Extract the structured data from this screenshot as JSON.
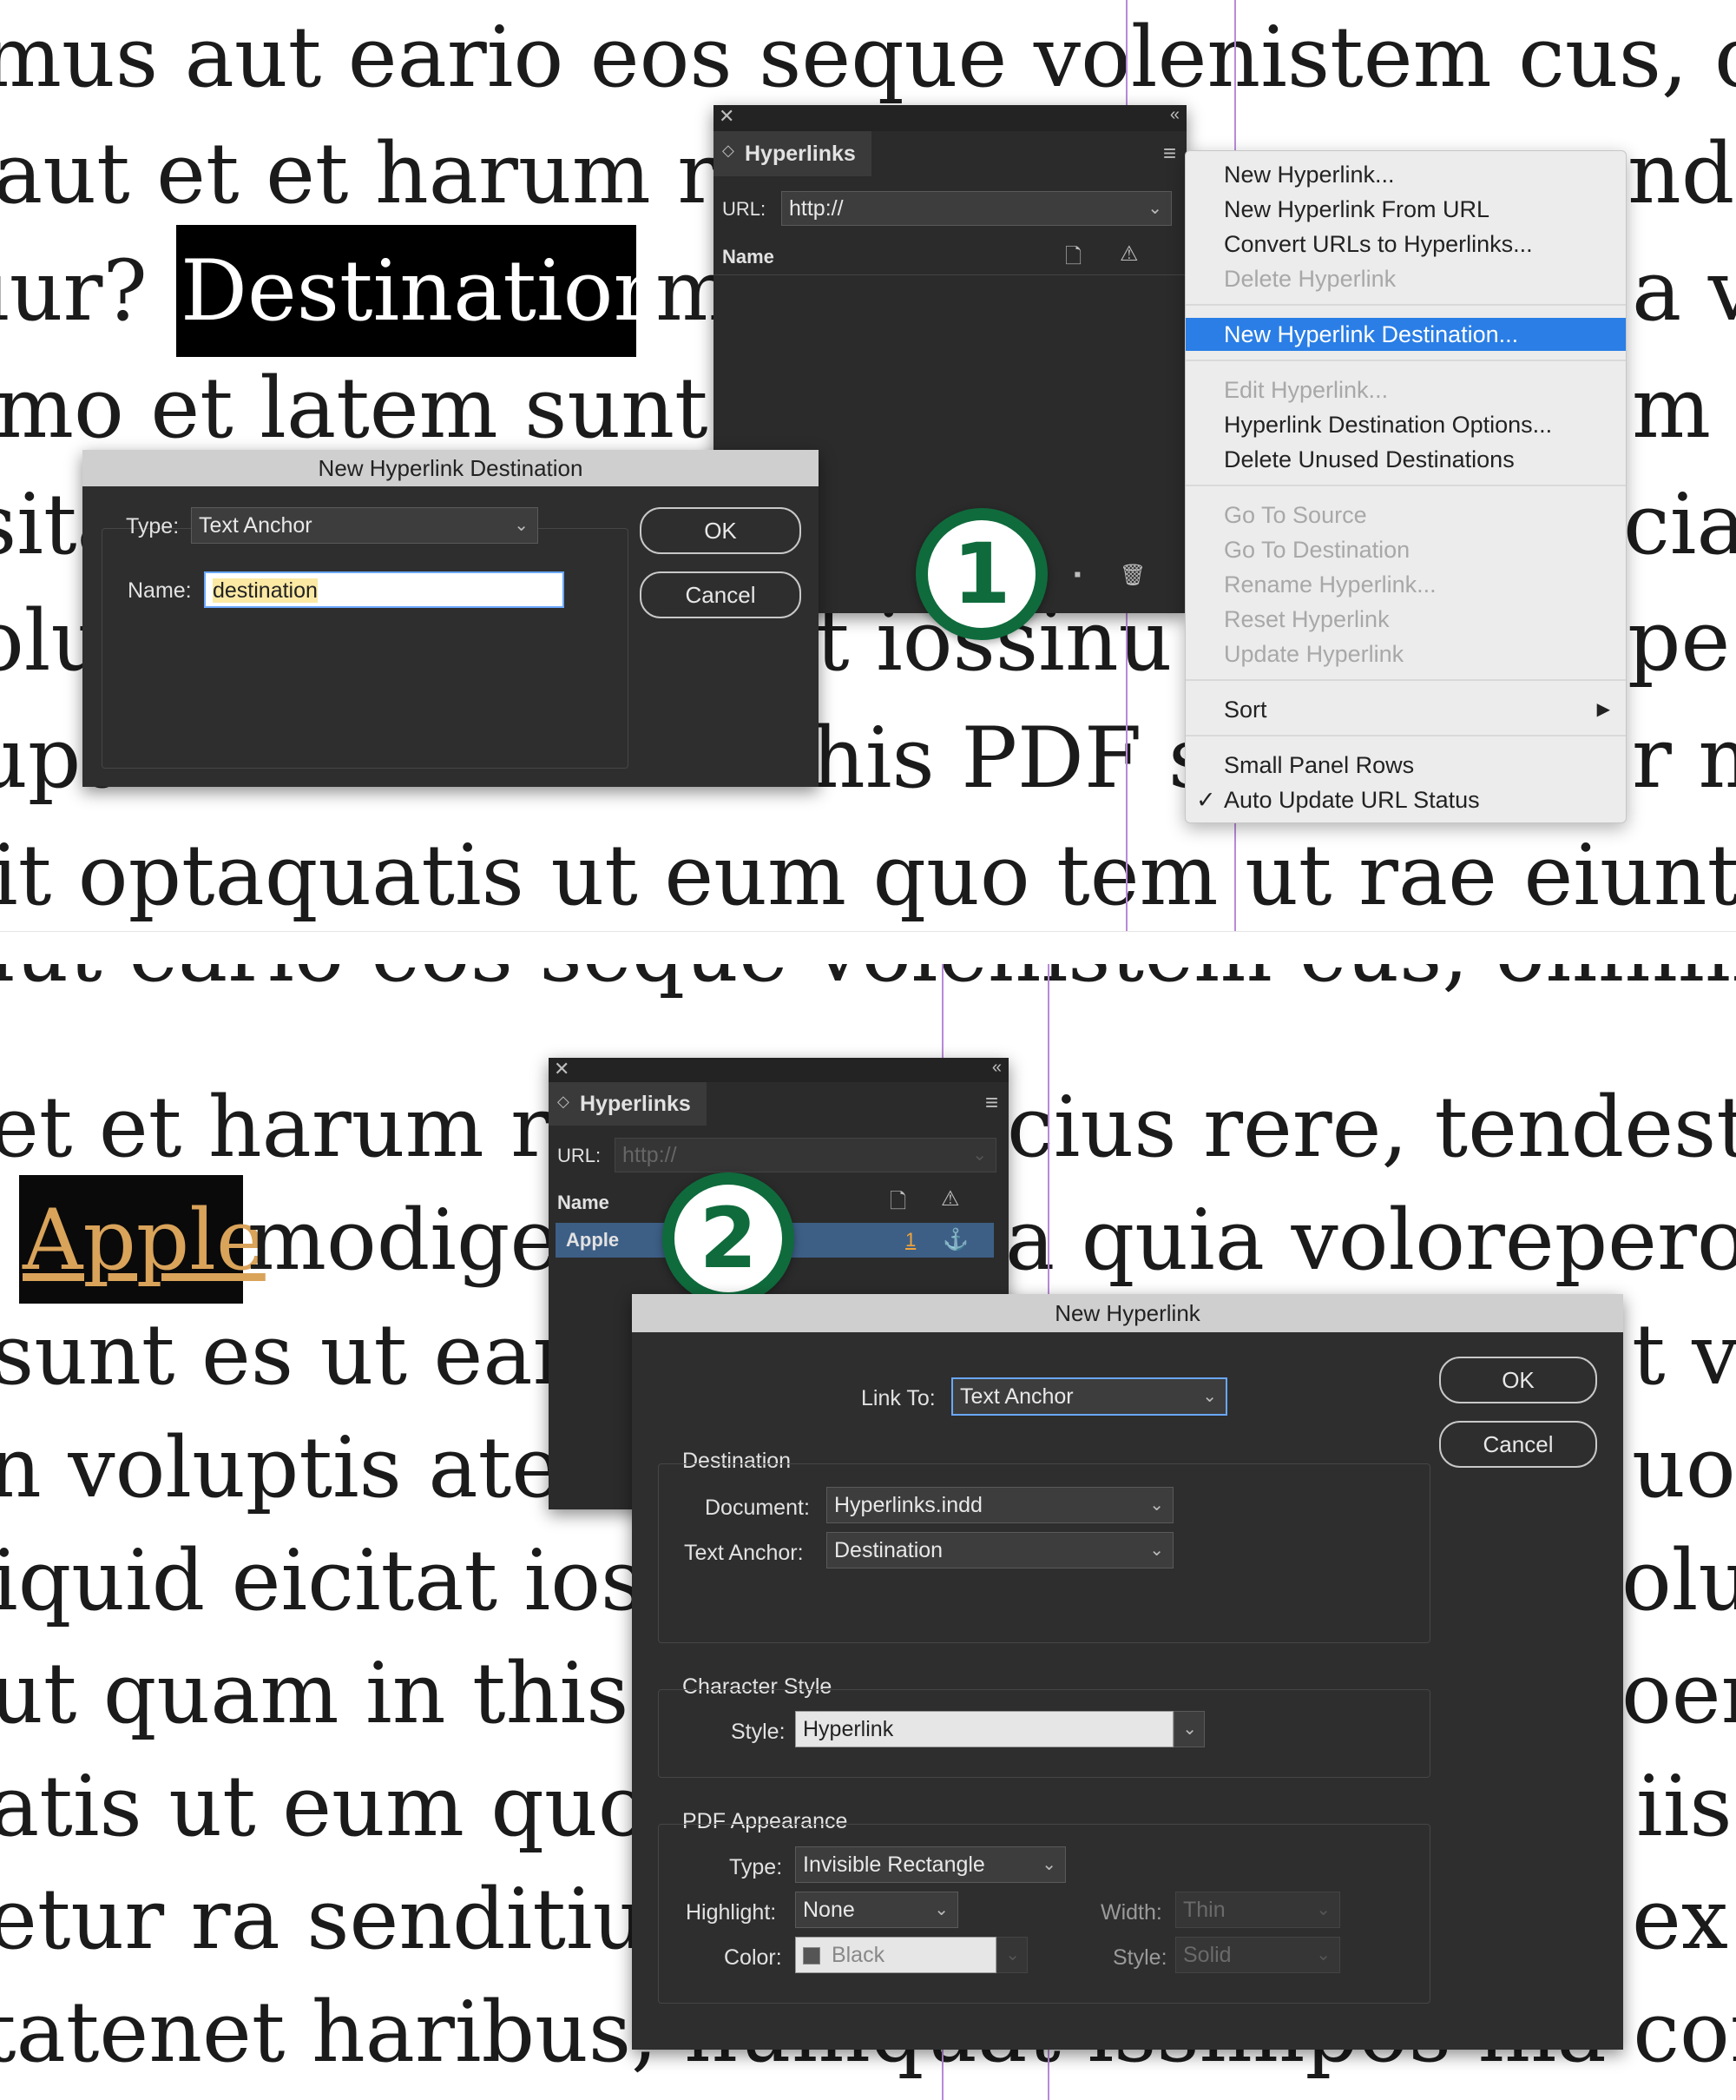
{
  "panel1": {
    "body_lines": [
      "mus aut eario eos seque volenistem cus, omnir",
      "aut et et harum rep",
      "iur? ",
      "mo et latem sunt es",
      "sita",
      "olu",
      "upt",
      "it optaquatis ut eum quo tem ut rae eiunt om"
    ],
    "right_fragments": [
      "nde",
      "a vo",
      "m v",
      "ciar",
      "pe",
      "r m"
    ],
    "mid_fragments": [
      "t iossinu ",
      "his PDF sa"
    ],
    "destination_word": "Destination",
    "destination_trailing": "m",
    "badge": "1",
    "hyperlinks_panel": {
      "title": "Hyperlinks",
      "url_label": "URL:",
      "url_value": "http://",
      "name_header": "Name"
    },
    "menu": {
      "items": [
        {
          "label": "New Hyperlink...",
          "state": "enabled"
        },
        {
          "label": "New Hyperlink From URL",
          "state": "enabled"
        },
        {
          "label": "Convert URLs to Hyperlinks...",
          "state": "enabled"
        },
        {
          "label": "Delete Hyperlink",
          "state": "disabled"
        },
        {
          "label": "New Hyperlink Destination...",
          "state": "highlighted"
        },
        {
          "label": "Edit Hyperlink...",
          "state": "disabled"
        },
        {
          "label": "Hyperlink Destination Options...",
          "state": "enabled"
        },
        {
          "label": "Delete Unused Destinations",
          "state": "enabled"
        },
        {
          "label": "Go To Source",
          "state": "disabled"
        },
        {
          "label": "Go To Destination",
          "state": "disabled"
        },
        {
          "label": "Rename Hyperlink...",
          "state": "disabled"
        },
        {
          "label": "Reset Hyperlink",
          "state": "disabled"
        },
        {
          "label": "Update Hyperlink",
          "state": "disabled"
        },
        {
          "label": "Sort",
          "state": "submenu"
        },
        {
          "label": "Small Panel Rows",
          "state": "enabled"
        },
        {
          "label": "Auto Update URL Status",
          "state": "checked"
        }
      ],
      "check_mark": "✓",
      "submenu_arrow": "▶"
    },
    "dest_dialog": {
      "title": "New Hyperlink Destination",
      "type_label": "Type:",
      "type_value": "Text Anchor",
      "name_label": "Name:",
      "name_value": "destination",
      "ok": "OK",
      "cancel": "Cancel"
    }
  },
  "panel2": {
    "top_line": "aut eario eos seque volenistem cus, omnim con",
    "left_fragments": [
      "et et harum rep",
      "",
      "sunt es ut earu",
      "n voluptis atec",
      "iquid eicitat iossi",
      "ut quam in this P",
      "atis ut eum quo te",
      "etur ra senditium",
      "tatenet haribus, numquat issimpos ma consed"
    ],
    "right_fragments": [
      "cius rere, tendest, co",
      "a quia volorepero co",
      "t vo",
      "uo",
      "olup",
      "oeru",
      "iis",
      "ex"
    ],
    "apple_word": "Apple",
    "apple_trailing": " modige",
    "badge": "2",
    "hyperlinks_panel": {
      "title": "Hyperlinks",
      "url_label": "URL:",
      "url_value": "http://",
      "name_header": "Name",
      "row_name": "Apple",
      "row_page": "1"
    },
    "new_hyperlink": {
      "title": "New Hyperlink",
      "link_to_label": "Link To:",
      "link_to_value": "Text Anchor",
      "ok": "OK",
      "cancel": "Cancel",
      "destination_section": "Destination",
      "document_label": "Document:",
      "document_value": "Hyperlinks.indd",
      "text_anchor_label": "Text Anchor:",
      "text_anchor_value": "Destination",
      "char_style_section": "Character Style",
      "style_label": "Style:",
      "style_value": "Hyperlink",
      "pdf_section": "PDF Appearance",
      "type_label": "Type:",
      "type_value": "Invisible Rectangle",
      "highlight_label": "Highlight:",
      "highlight_value": "None",
      "width_label": "Width:",
      "width_value": "Thin",
      "color_label": "Color:",
      "color_value": "Black",
      "style2_label": "Style:",
      "style2_value": "Solid"
    }
  },
  "colors": {
    "badge_green": "#0f6b3c",
    "menu_highlight": "#2a7ee6",
    "apple_text": "#d9a35a",
    "guide": "#b98ad9"
  }
}
